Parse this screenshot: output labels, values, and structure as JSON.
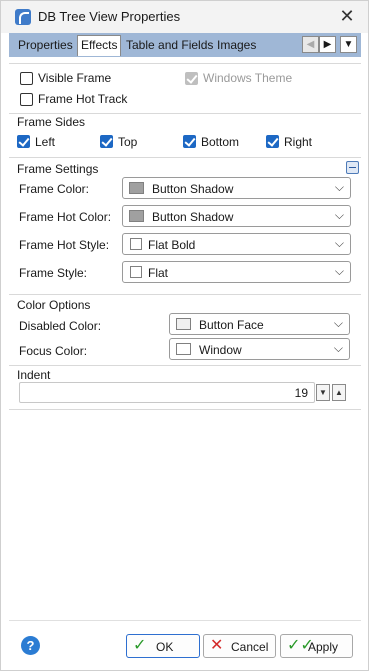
{
  "window": {
    "title": "DB Tree View Properties",
    "icon": "app-icon",
    "close_glyph": "✕"
  },
  "tabs": [
    {
      "label": "Properties"
    },
    {
      "label": "Effects",
      "active": true
    },
    {
      "label": "Table and Fields"
    },
    {
      "label": "Images"
    }
  ],
  "tab_nav": {
    "prev": "◀",
    "next": "▶",
    "menu": "▼"
  },
  "effects": {
    "visible_frame": {
      "label": "Visible Frame",
      "checked": false
    },
    "frame_hot_track": {
      "label": "Frame Hot Track",
      "checked": false
    },
    "windows_theme": {
      "label": "Windows Theme",
      "checked": true,
      "enabled": false
    }
  },
  "frame_sides": {
    "title": "Frame Sides",
    "left": {
      "label": "Left",
      "checked": true
    },
    "top": {
      "label": "Top",
      "checked": true
    },
    "bottom": {
      "label": "Bottom",
      "checked": true
    },
    "right": {
      "label": "Right",
      "checked": true
    }
  },
  "frame_settings": {
    "title": "Frame Settings",
    "frame_color": {
      "label": "Frame Color:",
      "value": "Button Shadow",
      "swatch": "#a0a0a0"
    },
    "frame_hot_color": {
      "label": "Frame Hot Color:",
      "value": "Button Shadow",
      "swatch": "#a0a0a0"
    },
    "frame_hot_style": {
      "label": "Frame Hot Style:",
      "value": "Flat Bold",
      "swatch": "#ffffff"
    },
    "frame_style": {
      "label": "Frame Style:",
      "value": "Flat",
      "swatch": "#ffffff"
    }
  },
  "color_options": {
    "title": "Color Options",
    "disabled_color": {
      "label": "Disabled Color:",
      "value": "Button Face",
      "swatch": "#f0f0f0"
    },
    "focus_color": {
      "label": "Focus Color:",
      "value": "Window",
      "swatch": "#ffffff"
    }
  },
  "indent": {
    "title": "Indent",
    "value": "19",
    "down": "▼",
    "up": "▲"
  },
  "footer": {
    "help": "?",
    "ok": "OK",
    "cancel": "Cancel",
    "apply": "Apply"
  },
  "colors": {
    "accent": "#1d68c4",
    "tab_bar": "#9fb7d6"
  }
}
